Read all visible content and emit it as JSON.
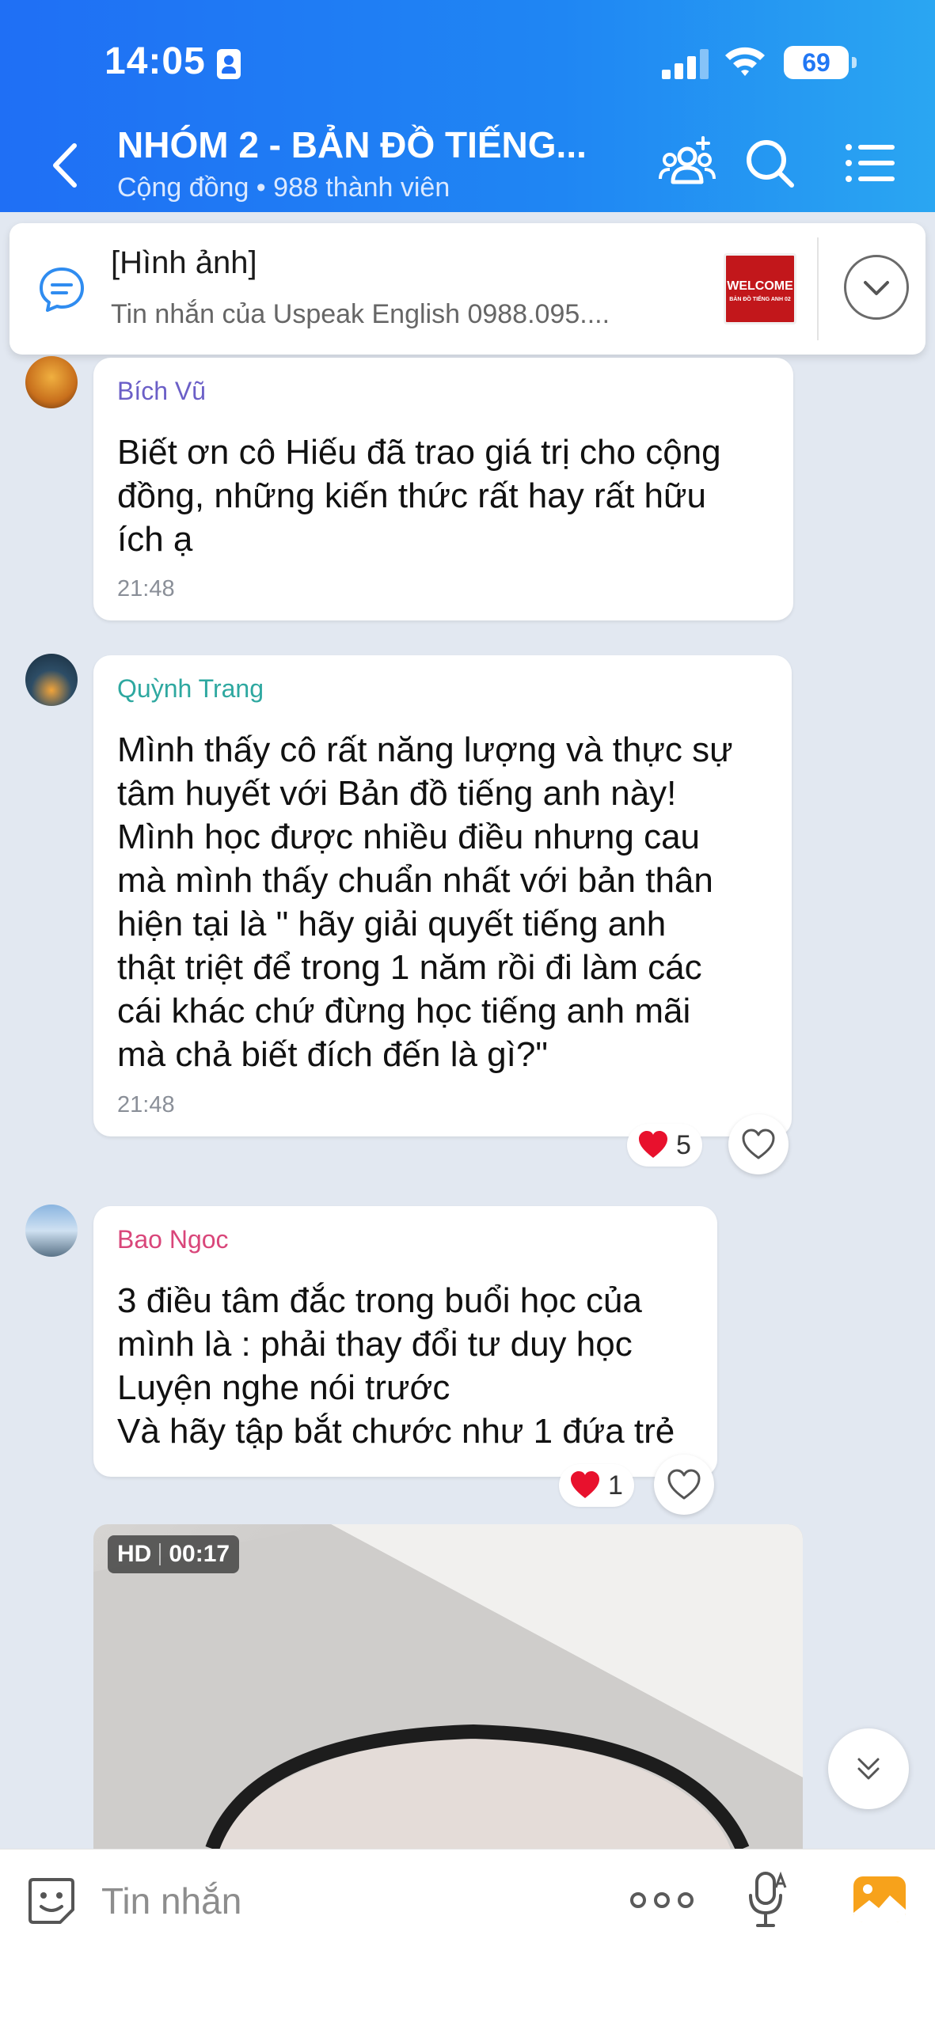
{
  "status_bar": {
    "time": "14:05",
    "battery": "69"
  },
  "header": {
    "title": "NHÓM 2 - BẢN ĐỒ TIẾNG...",
    "subtitle": "Cộng đồng • 988 thành viên"
  },
  "pinned": {
    "title": "[Hình ảnh]",
    "text": "Tin nhắn của Uspeak English 0988.095....",
    "thumb_text": "WELCOME",
    "thumb_subtext": "BẢN ĐỒ TIẾNG ANH 02"
  },
  "messages": [
    {
      "sender": "Bích Vũ",
      "sender_color": "#6b5fc7",
      "text": "Biết ơn cô Hiếu đã trao giá trị cho cộng\nđồng, những kiến thức rất hay rất hữu\ních ạ",
      "time": "21:48"
    },
    {
      "sender": "Quỳnh Trang",
      "sender_color": "#2ea8a0",
      "text": "Mình thấy cô rất năng lượng và thực sự\ntâm huyết với Bản đồ tiếng anh này!\nMình học được nhiều điều nhưng cau\nmà mình thấy chuẩn nhất với bản thân\nhiện tại là \" hãy giải quyết tiếng anh\nthật triệt để trong 1 năm rồi đi làm các\ncái khác chứ đừng học tiếng anh mãi\nmà chả biết đích đến là gì?\"",
      "time": "21:48",
      "reaction_count": "5"
    },
    {
      "sender": "Bao Ngoc",
      "sender_color": "#d9467a",
      "text": "3 điều tâm đắc trong buổi học của\nmình là : phải thay đổi tư duy học\nLuyện nghe nói trước\nVà hãy tập bắt chước như 1 đứa trẻ",
      "reaction_count": "1"
    }
  ],
  "video": {
    "quality": "HD",
    "duration": "00:17"
  },
  "input": {
    "placeholder": "Tin nhắn"
  }
}
